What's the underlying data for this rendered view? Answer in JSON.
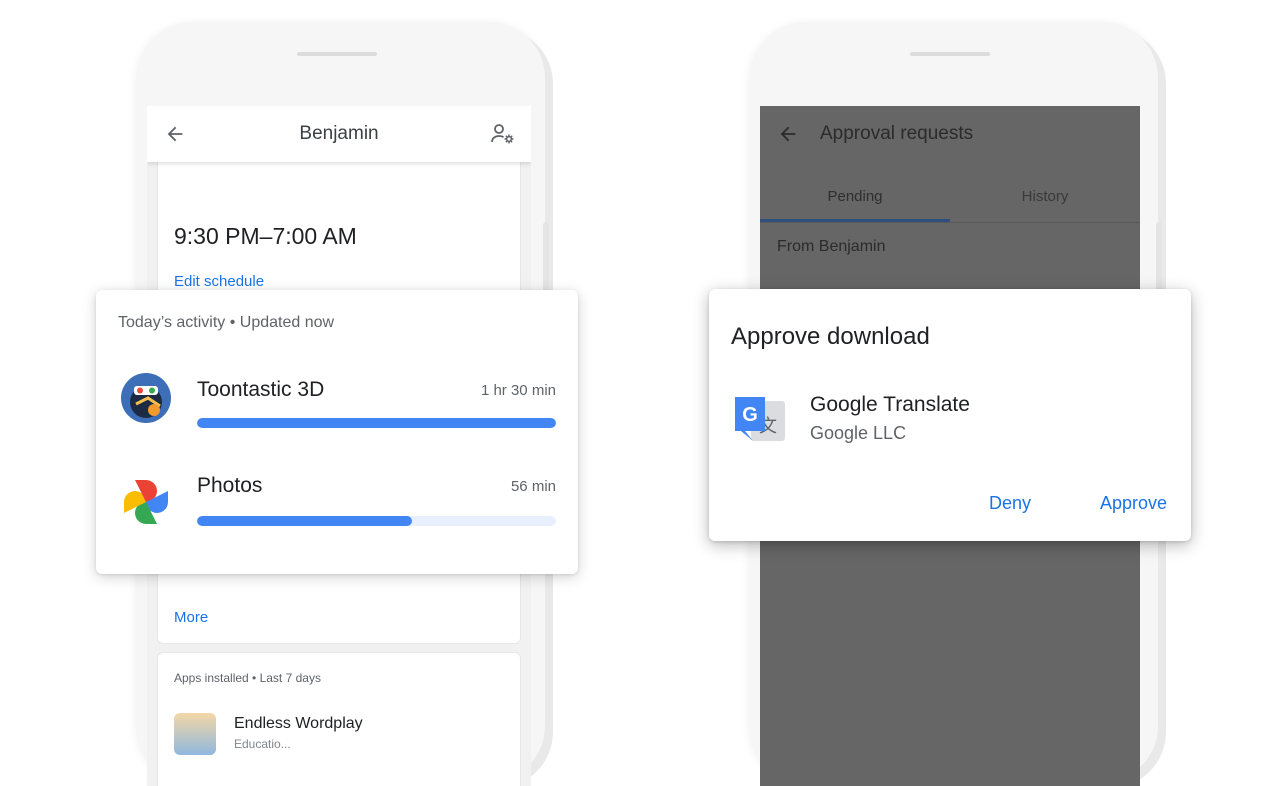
{
  "left_phone": {
    "appbar": {
      "title": "Benjamin",
      "back_icon": "arrow-back-icon",
      "settings_icon": "person-settings-icon"
    },
    "schedule_card": {
      "time_range": "9:30 PM–7:00 AM",
      "edit_link": "Edit schedule"
    },
    "more_link": "More",
    "installed_card": {
      "header": "Apps installed • Last 7 days",
      "app_name": "Endless Wordplay",
      "app_sub": "Educatio..."
    }
  },
  "activity_card": {
    "header": "Today’s activity • Updated now",
    "apps": [
      {
        "name": "Toontastic 3D",
        "time": "1 hr 30 min",
        "progress": 1.0,
        "icon": "toontastic-app-icon"
      },
      {
        "name": "Photos",
        "time": "56 min",
        "progress": 0.6,
        "icon": "google-photos-icon"
      }
    ]
  },
  "right_phone": {
    "appbar": {
      "title": "Approval requests",
      "back_icon": "arrow-back-icon"
    },
    "tabs": [
      {
        "label": "Pending",
        "active": true
      },
      {
        "label": "History",
        "active": false
      }
    ],
    "from_label": "From Benjamin"
  },
  "dialog": {
    "title": "Approve download",
    "app_name": "Google Translate",
    "developer": "Google LLC",
    "app_icon": "google-translate-icon",
    "deny_label": "Deny",
    "approve_label": "Approve"
  },
  "colors": {
    "accent": "#1a73e8",
    "progress_fill": "#4285f4",
    "progress_track": "#e8f0fd",
    "scrim": "#666666"
  }
}
